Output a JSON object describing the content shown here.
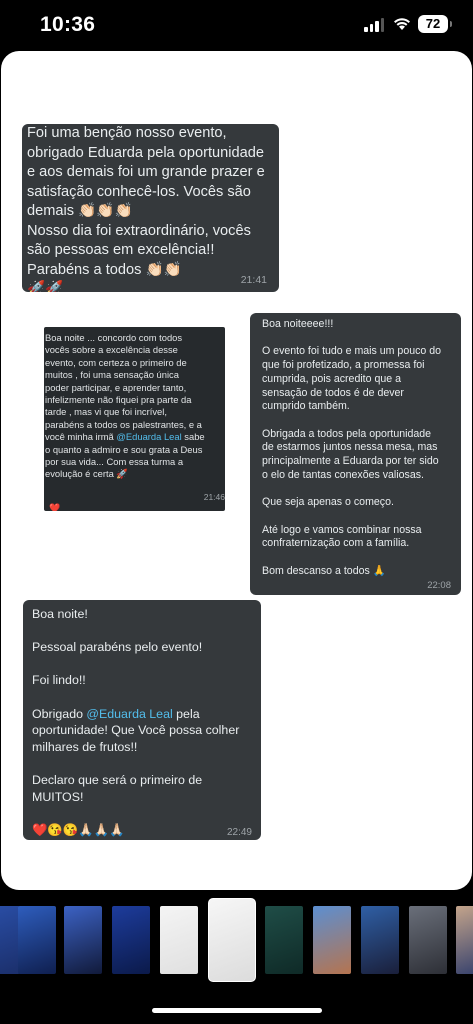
{
  "status_bar": {
    "time": "10:36",
    "battery": "72"
  },
  "messages": {
    "m1": {
      "text": "Foi uma benção nosso evento,\nobrigado Eduarda pela oportunidade\ne aos demais foi um grande prazer e\nsatisfação conhecê-los. Vocês são\ndemais 👏🏻👏🏻👏🏻\nNosso dia foi extraordinário, vocês\nsão pessoas em excelência!!\nParabéns a todos 👏🏻👏🏻\n🚀🚀",
      "time": "21:41"
    },
    "m2": {
      "before": "Boa noite ... concordo com todos\nvocês sobre a excelência desse\nevento, com certeza o primeiro de\nmuitos , foi uma sensação única\npoder participar, e aprender tanto,\ninfelizmente não fiquei pra parte da\ntarde , mas vi que foi incrível,\nparabéns a todos os palestrantes, e a\nvocê minha irmã ",
      "mention": "@Eduarda Leal",
      "after": "  sabe\no quanto a admiro e sou grata a Deus\npor sua vida... Com essa turma a\nevolução é certa 🚀",
      "time": "21:46",
      "reaction": "❤️"
    },
    "m3": {
      "text": "Boa noiteeee!!!\n\nO evento foi tudo e mais um pouco do\nque foi profetizado, a promessa foi\ncumprida, pois acredito que a\nsensação de todos é de dever\ncumprido também.\n\nObrigada a todos pela oportunidade\nde estarmos juntos nessa mesa, mas\nprincipalmente a Eduarda por ter sido\no elo de tantas conexões valiosas.\n\nQue seja apenas o começo.\n\nAté logo e vamos combinar nossa\nconfraternização com a família.\n\nBom descanso a todos 🙏",
      "time": "22:08"
    },
    "m4": {
      "before": "Boa noite!\n\nPessoal parabéns pelo evento!\n\nFoi lindo!!\n\nObrigado ",
      "mention": "@Eduarda Leal",
      "after": " pela\noportunidade! Que Você possa colher\nmilhares de frutos!!\n\nDeclaro que será o primeiro de\nMUITOS!\n\n❤️😘😘🙏🏻🙏🏻🙏🏻",
      "time": "22:49"
    }
  },
  "thumbnails": [
    {
      "icon": "people-photo-thumbnail",
      "colors": [
        "#2a4fa8",
        "#1b2f6b"
      ]
    },
    {
      "icon": "group-photo-thumbnail",
      "colors": [
        "#2e5dbd",
        "#0f1f4f"
      ]
    },
    {
      "icon": "event-stage-thumbnail",
      "colors": [
        "#3c62c4",
        "#111a3a"
      ]
    },
    {
      "icon": "speaker-portrait-thumbnail",
      "colors": [
        "#1d3c9c",
        "#0b1a4a"
      ]
    },
    {
      "icon": "document-thumbnail",
      "colors": [
        "#f4f4f4",
        "#e0e0e0"
      ]
    },
    {
      "icon": "chat-collage-thumbnail",
      "colors": [
        "#f6f6f6",
        "#dcdcdc"
      ]
    },
    {
      "icon": "chat-screenshot-thumbnail",
      "colors": [
        "#1f4d47",
        "#0f2a27"
      ]
    },
    {
      "icon": "selfie-thumbnail",
      "colors": [
        "#5c8fd1",
        "#b5744f"
      ]
    },
    {
      "icon": "stage-photo-thumbnail",
      "colors": [
        "#2f5fa5",
        "#1a1f3a"
      ]
    },
    {
      "icon": "venue-photo-thumbnail",
      "colors": [
        "#6a6f7a",
        "#2d2f36"
      ]
    },
    {
      "icon": "portrait-photo-thumbnail",
      "colors": [
        "#c4a48b",
        "#2d3b6b"
      ]
    }
  ]
}
